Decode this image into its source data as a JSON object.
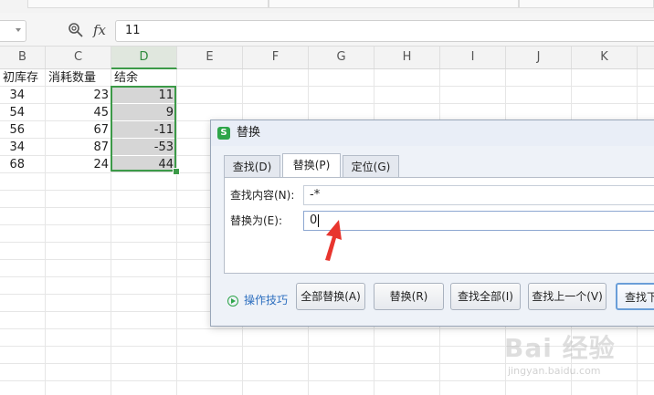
{
  "formula_bar": {
    "fx_label": "fx",
    "content": "11"
  },
  "columns": [
    "B",
    "C",
    "D",
    "E",
    "F",
    "G",
    "H",
    "I",
    "J",
    "K"
  ],
  "sheet": {
    "headers": {
      "b": "初库存",
      "c": "消耗数量",
      "d": "结余"
    },
    "rows": [
      {
        "b": "34",
        "c": "23",
        "d": "11"
      },
      {
        "b": "54",
        "c": "45",
        "d": "9"
      },
      {
        "b": "56",
        "c": "67",
        "d": "-11"
      },
      {
        "b": "34",
        "c": "87",
        "d": "-53"
      },
      {
        "b": "68",
        "c": "24",
        "d": "44"
      }
    ]
  },
  "dialog": {
    "title": "替换",
    "logo_letter": "S",
    "tabs": [
      "查找(D)",
      "替换(P)",
      "定位(G)"
    ],
    "active_tab": "替换(P)",
    "find_label": "查找内容(N):",
    "find_value": "-*",
    "replace_label": "替换为(E):",
    "replace_value": "0",
    "tips_label": "操作技巧",
    "buttons": {
      "replace_all": "全部替换(A)",
      "replace": "替换(R)",
      "find_all": "查找全部(I)",
      "find_prev": "查找上一个(V)",
      "find_next": "查找下"
    }
  },
  "watermark": {
    "brand": "Bai 经验",
    "url": "jingyan.baidu.com"
  },
  "colors": {
    "selection_green": "#3c9a48",
    "annotation_red": "#e8352e",
    "link_blue": "#2d6fbf"
  }
}
